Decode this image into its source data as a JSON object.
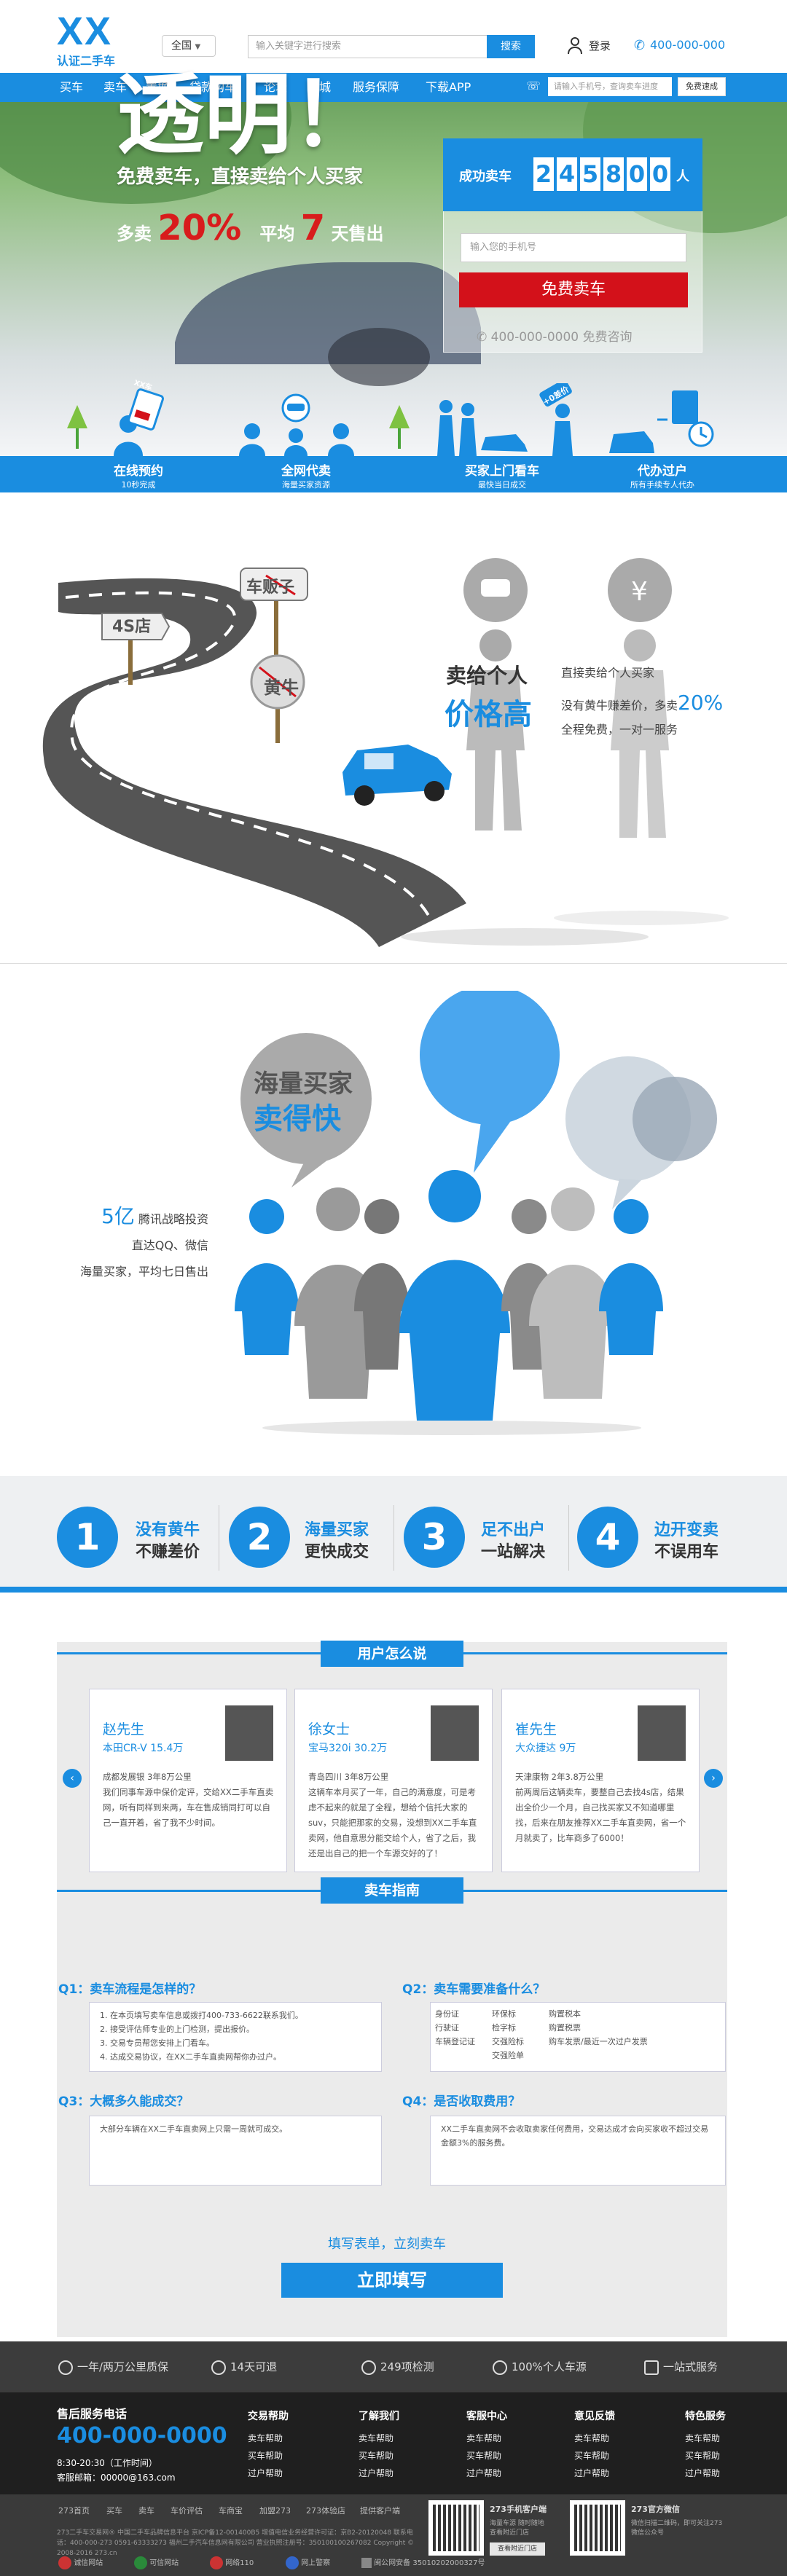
{
  "header": {
    "logo": "XX",
    "logo_sub": "认证二手车",
    "city": "全国",
    "search_placeholder": "输入关键字进行搜索",
    "search_btn": "搜索",
    "login": "登录",
    "phone": "400-000-000"
  },
  "nav": {
    "items": [
      "买车",
      "卖车",
      "置换",
      "贷款购车",
      "论坛",
      "商城",
      "服务保障",
      "下载APP"
    ],
    "search_placeholder": "请输入手机号，查询卖车进度",
    "search_btn": "免费速成"
  },
  "hero": {
    "title": "透明！",
    "subtitle": "免费卖车，直接卖给个人买家",
    "stat_pre": "多卖",
    "stat_pct": "20%",
    "stat_mid": "平均",
    "stat_days": "7",
    "stat_post": "天售出",
    "panel_label": "成功卖车",
    "digits": [
      "2",
      "4",
      "5",
      "8",
      "0",
      "0"
    ],
    "panel_unit": "人",
    "phone_placeholder": "输入您的手机号",
    "sell_btn": "免费卖车",
    "consult": "400-000-0000 免费咨询",
    "badge_text": "XX车",
    "price_tag": "+0差价",
    "steps": [
      {
        "title": "在线预约",
        "sub": "10秒完成"
      },
      {
        "title": "全网代卖",
        "sub": "海量买家资源"
      },
      {
        "title": "买家上门看车",
        "sub": "最快当日成交"
      },
      {
        "title": "代办过户",
        "sub": "所有手续专人代办"
      }
    ]
  },
  "section_road": {
    "sign1": "4S店",
    "sign2": "车贩子",
    "sign3": "黄牛",
    "title1": "卖给个人",
    "title2": "价格高",
    "line1": "直接卖给个人买家",
    "line2_pre": "没有黄牛赚差价，多卖",
    "line2_pct": "20%",
    "line3": "全程免费，一对一服务",
    "yen": "¥"
  },
  "section_buyers": {
    "bubble1": "海量买家",
    "bubble2": "卖得快",
    "l1_num": "5亿",
    "l1_text": "腾讯战略投资",
    "l2": "直达QQ、微信",
    "l3": "海量买家，平均七日售出"
  },
  "features": [
    {
      "num": "1",
      "a": "没有黄牛",
      "b": "不赚差价"
    },
    {
      "num": "2",
      "a": "海量买家",
      "b": "更快成交"
    },
    {
      "num": "3",
      "a": "足不出户",
      "b": "一站解决"
    },
    {
      "num": "4",
      "a": "边开变卖",
      "b": "不误用车"
    }
  ],
  "testimonials": {
    "heading": "用户怎么说",
    "prev": "‹",
    "next": "›",
    "cards": [
      {
        "name": "赵先生",
        "car": "本田CR-V   15.4万",
        "text": "成都发展银    3年8万公里\n我们同事车源中保价定评，交给XX二手车直卖网，听有同样到来两，车在售成销同打可以自己一直开着，省了我不少时间。"
      },
      {
        "name": "徐女士",
        "car": "宝马320i   30.2万",
        "text": "青岛四川    3年8万公里\n这辆车本月买了一年，自己的满意度，可是考虑不起来的就是了全程，想给个信托大家的suv，只能把那家的交易，没想到XX二手车直卖网，他自意思分能交给个人，省了之后，我还是出自己的把一个车源交好的了！"
      },
      {
        "name": "崔先生",
        "car": "大众捷达   9万",
        "text": "天津康物    2年3.8万公里\n前两周后这辆卖车，要整自己去找4s店，结果出全价少一个月，自己找买家又不知道哪里找，后来在朋友推荐XX二手车直卖网，省一个月就卖了，比车商多了6000！"
      }
    ]
  },
  "guide": {
    "heading": "卖车指南",
    "q1": "Q1：卖车流程是怎样的？",
    "q1_items": [
      "1. 在本页填写卖车信息或拨打400-733-6622联系我们。",
      "2. 接受评估师专业的上门检测，提出报价。",
      "3. 交易专员帮您安排上门看车。",
      "4. 达成交易协议，在XX二手车直卖网帮你办过户。"
    ],
    "q2": "Q2：卖车需要准备什么？",
    "q2_rows": [
      [
        "身份证",
        "环保标",
        "购置税本"
      ],
      [
        "行驶证",
        "检字标",
        "购置税票"
      ],
      [
        "车辆登记证",
        "交强险标",
        "购车发票/最近一次过户发票"
      ],
      [
        "",
        "交强险单",
        ""
      ]
    ],
    "q3": "Q3：大概多久能成交？",
    "q3_text": "大部分车辆在XX二手车直卖网上只需一周就可成交。",
    "q4": "Q4：是否收取费用？",
    "q4_text": "XX二手车直卖网不会收取卖家任何费用，交易达成才会向买家收不超过交易金额3%的服务费。",
    "cta_text": "填写表单，立刻卖车",
    "cta_btn": "立即填写"
  },
  "footer": {
    "guarantees": [
      "一年/两万公里质保",
      "14天可退",
      "249项检测",
      "100%个人车源",
      "一站式服务"
    ],
    "hotline_label": "售后服务电话",
    "hotline": "400-000-0000",
    "hours": "8:30-20:30（工作时间）",
    "email": "客服邮箱：00000@163.com",
    "cols": [
      {
        "h": "交易帮助",
        "items": [
          "卖车帮助",
          "买车帮助",
          "过户帮助"
        ]
      },
      {
        "h": "了解我们",
        "items": [
          "卖车帮助",
          "买车帮助",
          "过户帮助"
        ]
      },
      {
        "h": "客服中心",
        "items": [
          "卖车帮助",
          "买车帮助",
          "过户帮助"
        ]
      },
      {
        "h": "意见反馈",
        "items": [
          "卖车帮助",
          "买车帮助",
          "过户帮助"
        ]
      },
      {
        "h": "特色服务",
        "items": [
          "卖车帮助",
          "买车帮助",
          "过户帮助"
        ]
      }
    ],
    "links": [
      "273首页",
      "买车",
      "卖车",
      "车价评估",
      "车商宝",
      "加盟273",
      "273体验店",
      "提供客户端"
    ],
    "copyright": "273二手车交易网®  中国二手车品牌信息平台  京ICP备12-001400B5  增值电信业务经营许可证：京B2-20120048  联系电话：400-000-273 0591-63333273  福州二手汽车信息网有限公司  营业执照注册号：350100100267082  Copyright © 2008-2016 273.cn",
    "app1": "273手机客户端",
    "app1_sub": "海量车源 随时随地\n查看附近门店",
    "app1_btn": "查看附近门店",
    "app2": "273官方微信",
    "app2_sub": "微信扫描二维码，即可关注273微信公众号\n",
    "badges": [
      "诚信网站",
      "可信网站",
      "网络110",
      "网上警察",
      "闽公网安备 35010202000327号"
    ]
  }
}
